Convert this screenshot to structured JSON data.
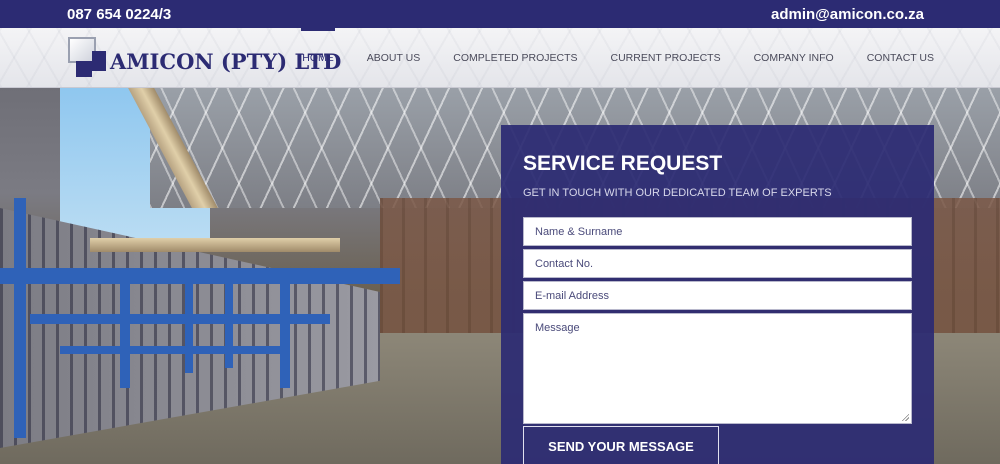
{
  "topbar": {
    "phone": "087 654 0224/3",
    "email": "admin@amicon.co.za"
  },
  "brand": {
    "name": "AMICON (PTY) LTD",
    "primary_color": "#2c2b73"
  },
  "nav": {
    "items": [
      {
        "label": "HOME",
        "active": true
      },
      {
        "label": "ABOUT US",
        "active": false
      },
      {
        "label": "COMPLETED PROJECTS",
        "active": false
      },
      {
        "label": "CURRENT PROJECTS",
        "active": false
      },
      {
        "label": "COMPANY INFO",
        "active": false
      },
      {
        "label": "CONTACT US",
        "active": false
      }
    ]
  },
  "form": {
    "title": "SERVICE REQUEST",
    "subtitle": "GET IN TOUCH WITH OUR DEDICATED TEAM OF EXPERTS",
    "name_placeholder": "Name & Surname",
    "contact_placeholder": "Contact No.",
    "email_placeholder": "E-mail Address",
    "message_placeholder": "Message",
    "submit_label": "SEND YOUR MESSAGE"
  }
}
